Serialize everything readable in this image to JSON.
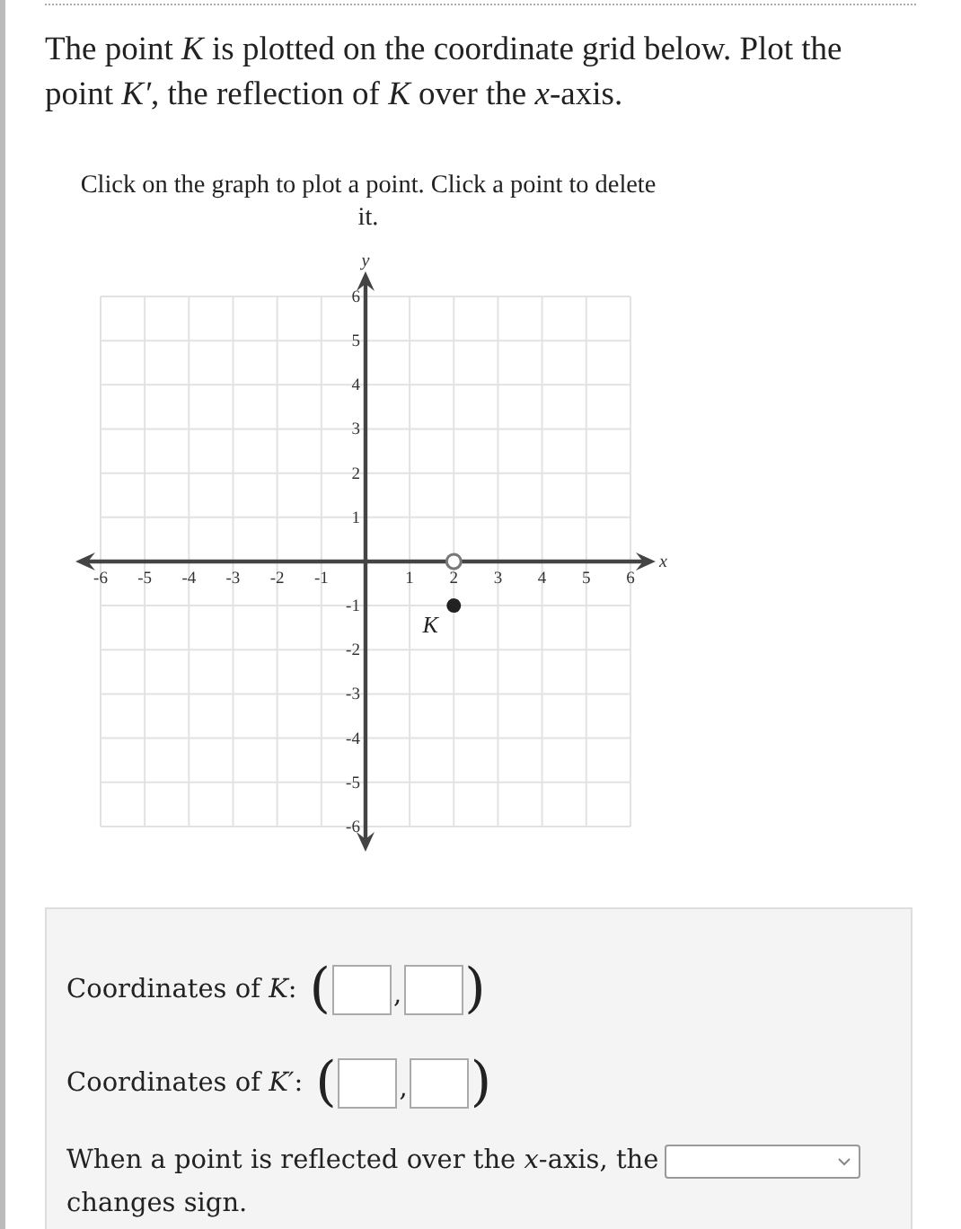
{
  "question": "The point *K* is plotted on the coordinate grid below. Plot the point *K′*, the reflection of *K* over the *x*-axis.",
  "instructions": "Click on the graph to plot a point. Click a point to delete it.",
  "graph": {
    "chart_data": {
      "type": "scatter",
      "xlabel": "x",
      "ylabel": "y",
      "xlim": [
        -6,
        6
      ],
      "ylim": [
        -6,
        6
      ],
      "xticks": [
        -6,
        -5,
        -4,
        -3,
        -2,
        -1,
        1,
        2,
        3,
        4,
        5,
        6
      ],
      "yticks": [
        -6,
        -5,
        -4,
        -3,
        -2,
        -1,
        1,
        2,
        3,
        4,
        5,
        6
      ],
      "grid": true,
      "x": [
        2
      ],
      "series": [
        {
          "name": "K",
          "color": "#222222",
          "values": [
            -1
          ]
        },
        {
          "color": "#777777",
          "values": [
            0
          ]
        }
      ]
    }
  },
  "answers": [
    {
      "label": "Coordinates of *K*:",
      "open": "(",
      "separator": ",",
      "close": ")",
      "fields": [
        {
          "kind": "blank"
        },
        {
          "kind": "blank"
        }
      ]
    },
    {
      "label": "Coordinates of *K′*:",
      "open": "(",
      "separator": ",",
      "close": ")",
      "fields": [
        {
          "kind": "blank"
        },
        {
          "kind": "blank"
        }
      ]
    }
  ],
  "sentence": {
    "before": "When a point is reflected over the *x*-axis, the",
    "dropdown": {
      "kind": "select"
    },
    "after": "changes sign."
  }
}
